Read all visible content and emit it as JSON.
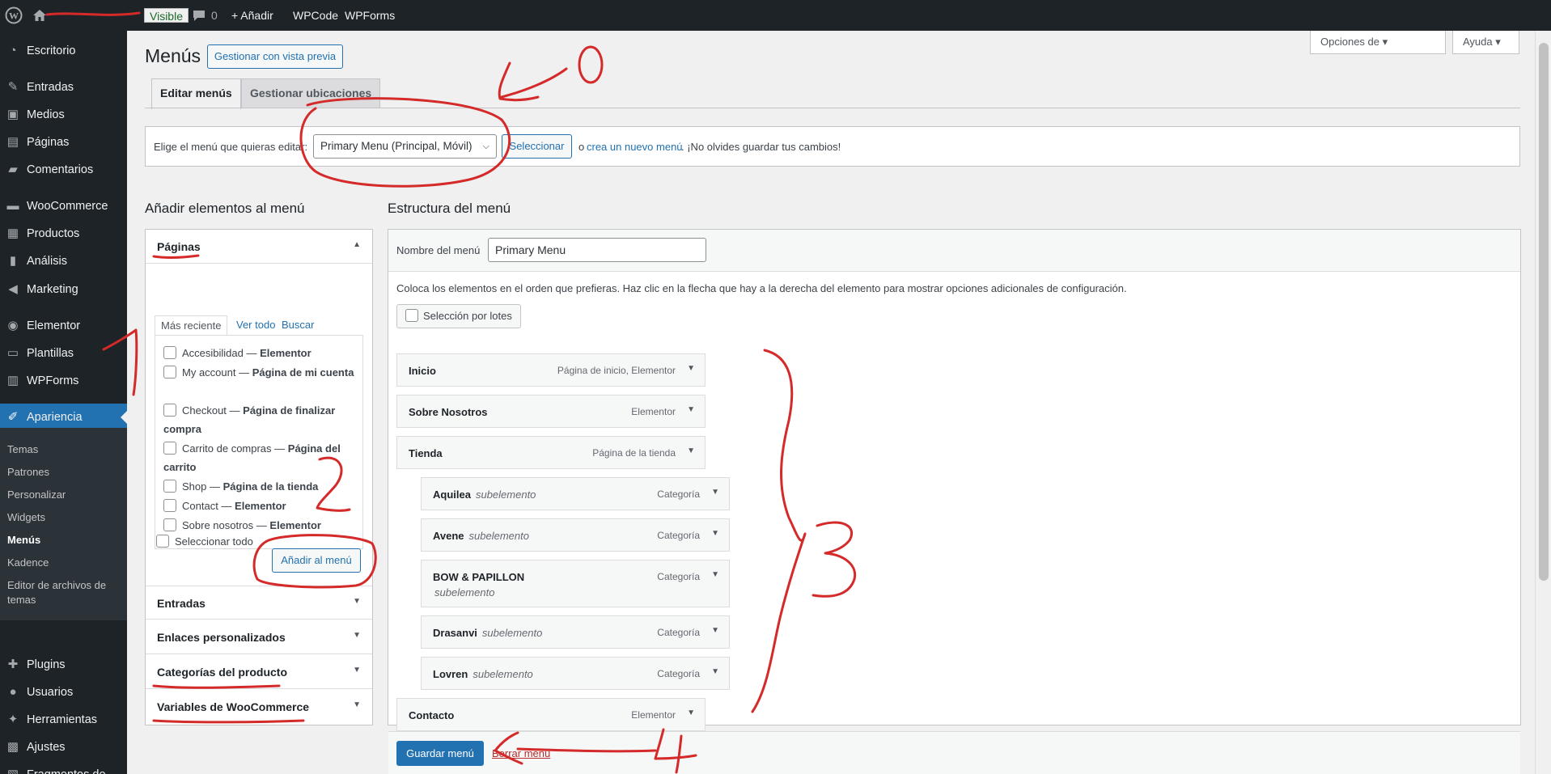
{
  "admin_bar": {
    "wp_logo_icon": "wordpress-icon",
    "home_icon": "home-icon",
    "visible_badge": "Visible",
    "comments_count": "0",
    "add_new": "+ Añadir",
    "wpcode": "WPCode",
    "wpforms": "WPForms"
  },
  "sidebar": {
    "items": [
      {
        "label": "Escritorio",
        "icon": "dashboard-icon"
      },
      {
        "label": "Entradas",
        "icon": "pin-icon"
      },
      {
        "label": "Medios",
        "icon": "media-icon"
      },
      {
        "label": "Páginas",
        "icon": "pages-icon"
      },
      {
        "label": "Comentarios",
        "icon": "comments-icon"
      },
      {
        "label": "WooCommerce",
        "icon": "woocommerce-icon"
      },
      {
        "label": "Productos",
        "icon": "products-icon"
      },
      {
        "label": "Análisis",
        "icon": "analytics-icon"
      },
      {
        "label": "Marketing",
        "icon": "megaphone-icon"
      },
      {
        "label": "Elementor",
        "icon": "elementor-icon"
      },
      {
        "label": "Plantillas",
        "icon": "folder-icon"
      },
      {
        "label": "WPForms",
        "icon": "wpforms-icon"
      },
      {
        "label": "Apariencia",
        "icon": "brush-icon"
      },
      {
        "label": "Plugins",
        "icon": "plugin-icon"
      },
      {
        "label": "Usuarios",
        "icon": "users-icon"
      },
      {
        "label": "Herramientas",
        "icon": "wrench-icon"
      },
      {
        "label": "Ajustes",
        "icon": "settings-icon"
      },
      {
        "label": "Fragmentos de código",
        "icon": "code-icon"
      }
    ],
    "submenu": [
      {
        "label": "Temas"
      },
      {
        "label": "Patrones"
      },
      {
        "label": "Personalizar"
      },
      {
        "label": "Widgets"
      },
      {
        "label": "Menús"
      },
      {
        "label": "Kadence"
      },
      {
        "label": "Editor de archivos de temas"
      }
    ]
  },
  "screen_options": {
    "options_label": "Opciones de ▾",
    "help_label": "Ayuda ▾"
  },
  "page": {
    "title": "Menús",
    "preview_button": "Gestionar con vista previa",
    "tabs": [
      {
        "label": "Editar menús"
      },
      {
        "label": "Gestionar ubicaciones"
      }
    ]
  },
  "manage_bar": {
    "prompt": "Elige el menú que quieras editar:",
    "selected_menu": "Primary Menu (Principal, Móvil)",
    "select_button": "Seleccionar",
    "or_text": "o",
    "create_link": "crea un nuevo menú",
    "reminder": ". ¡No olvides guardar tus cambios!"
  },
  "add_items": {
    "title": "Añadir elementos al menú",
    "sections": [
      {
        "label": "Páginas"
      },
      {
        "label": "Entradas"
      },
      {
        "label": "Enlaces personalizados"
      },
      {
        "label": "Categorías del producto"
      },
      {
        "label": "Variables de WooCommerce"
      }
    ],
    "page_tabs": [
      {
        "label": "Más reciente"
      },
      {
        "label": "Ver todo"
      },
      {
        "label": "Buscar"
      }
    ],
    "pages": [
      {
        "title": "Accesibilidad",
        "state": "Elementor"
      },
      {
        "title": "My account",
        "state": "Página de mi cuenta"
      },
      {
        "title": "Checkout",
        "state": "Página de finalizar compra"
      },
      {
        "title": "Carrito de compras",
        "state": "Página del carrito"
      },
      {
        "title": "Shop",
        "state": "Página de la tienda"
      },
      {
        "title": "Contact",
        "state": "Elementor"
      },
      {
        "title": "Sobre nosotros",
        "state": "Elementor"
      }
    ],
    "dash": " — ",
    "select_all": "Seleccionar todo",
    "add_button": "Añadir al menú"
  },
  "structure": {
    "title": "Estructura del menú",
    "name_label": "Nombre del menú",
    "name_value": "Primary Menu",
    "instructions": "Coloca los elementos en el orden que prefieras. Haz clic en la flecha que hay a la derecha del elemento para mostrar opciones adicionales de configuración.",
    "bulk_select": "Selección por lotes",
    "sub_label": "subelemento",
    "items": [
      {
        "title": "Inicio",
        "type": "Página de inicio, Elementor",
        "depth": 0
      },
      {
        "title": "Sobre Nosotros",
        "type": "Elementor",
        "depth": 0
      },
      {
        "title": "Tienda",
        "type": "Página de la tienda",
        "depth": 0
      },
      {
        "title": "Aquilea",
        "type": "Categoría",
        "depth": 1
      },
      {
        "title": "Avene",
        "type": "Categoría",
        "depth": 1
      },
      {
        "title": "BOW & PAPILLON",
        "type": "Categoría",
        "depth": 1
      },
      {
        "title": "Drasanvi",
        "type": "Categoría",
        "depth": 1
      },
      {
        "title": "Lovren",
        "type": "Categoría",
        "depth": 1
      },
      {
        "title": "Contacto",
        "type": "Elementor",
        "depth": 0
      }
    ],
    "save_button": "Guardar menú",
    "delete_link": "Borrar menú"
  },
  "annotations": {
    "labels": [
      "0",
      "1",
      "2",
      "3",
      "4"
    ],
    "color": "#d42a2a"
  },
  "colors": {
    "accent": "#2271b1",
    "sidebar_bg": "#1d2327",
    "admin_bar_bg": "#1d2327"
  }
}
